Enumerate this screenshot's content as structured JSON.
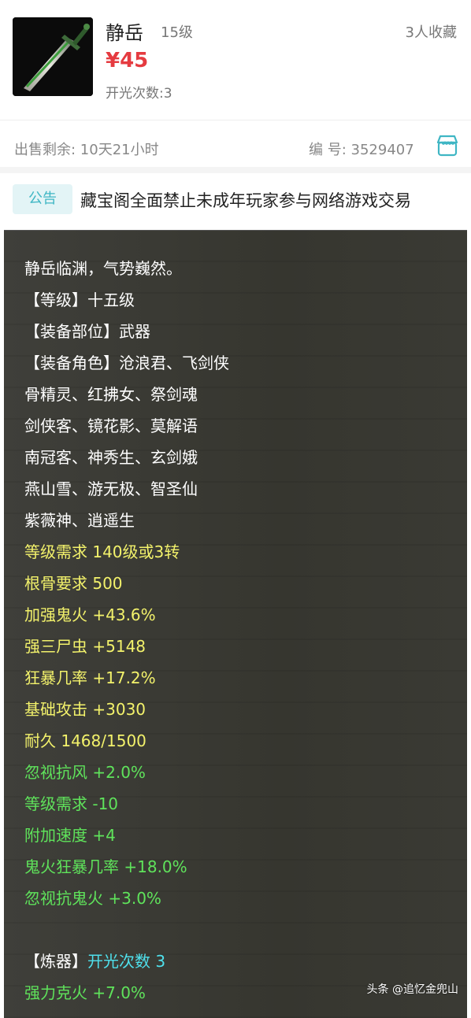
{
  "item": {
    "name": "静岳",
    "level": "15级",
    "favorites": "3人收藏",
    "price": "¥45",
    "open_count": "开光次数:3"
  },
  "sale": {
    "time_left": "出售剩余:  10天21小时",
    "serial": "编  号:  3529407"
  },
  "notice": {
    "badge": "公告",
    "text": "藏宝阁全面禁止未成年玩家参与网络游戏交易"
  },
  "description": {
    "intro": "静岳临渊，气势巍然。",
    "level_line": "【等级】十五级",
    "slot_line": "【装备部位】武器",
    "roles_line": "【装备角色】沧浪君、飞剑侠",
    "roles_2": "骨精灵、红拂女、祭剑魂",
    "roles_3": "剑侠客、镜花影、莫解语",
    "roles_4": "南冠客、神秀生、玄剑娥",
    "roles_5": "燕山雪、游无极、智圣仙",
    "roles_6": "紫薇神、逍遥生",
    "req_level": "等级需求 140级或3转",
    "req_bone": "根骨要求 500",
    "attr_1": "加强鬼火 +43.6%",
    "attr_2": "强三尸虫 +5148",
    "attr_3": "狂暴几率 +17.2%",
    "attr_4": "基础攻击 +3030",
    "durability": "耐久 1468/1500",
    "extra_1": "忽视抗风 +2.0%",
    "extra_2": "等级需求 -10",
    "extra_3": "附加速度 +4",
    "extra_4": "鬼火狂暴几率 +18.0%",
    "extra_5": "忽视抗鬼火 +3.0%",
    "refine_label": "【炼器】",
    "refine_value": "开光次数 3",
    "refine_1": "强力克火 +7.0%"
  },
  "watermark": "头条 @追忆金兜山",
  "colors": {
    "price": "#e53b40",
    "notice_badge_bg": "#e3f4f6",
    "notice_badge_text": "#3fb6c4",
    "panel_bg": "#3a3a35",
    "text_white": "#ffffff",
    "text_yellow": "#f3f26b",
    "text_green": "#5fe35b",
    "text_cyan": "#4fe0ec"
  },
  "icons": {
    "item_image": "sword-icon",
    "shop": "shop-icon"
  }
}
